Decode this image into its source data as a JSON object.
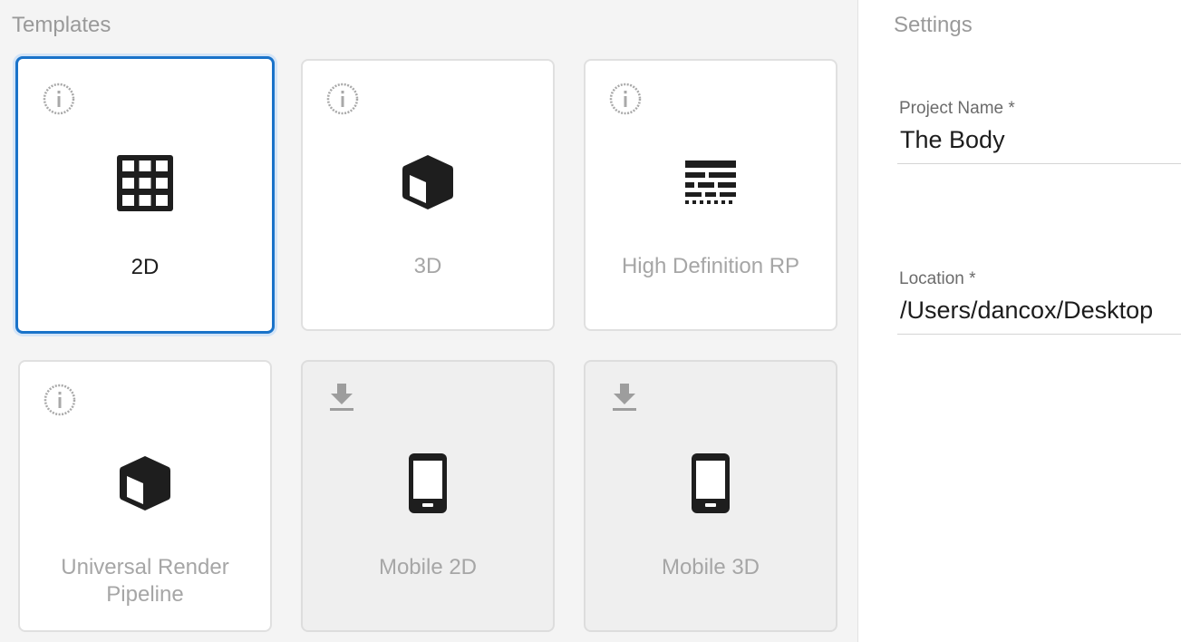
{
  "templates": {
    "title": "Templates",
    "cards": [
      {
        "label": "2D",
        "corner_icon": "info-icon",
        "main_icon": "grid-icon",
        "selected": true,
        "downloadable": false
      },
      {
        "label": "3D",
        "corner_icon": "info-icon",
        "main_icon": "cube-icon",
        "selected": false,
        "downloadable": false
      },
      {
        "label": "High Definition RP",
        "corner_icon": "info-icon",
        "main_icon": "brick-wall-icon",
        "selected": false,
        "downloadable": false
      },
      {
        "label": "Universal Render Pipeline",
        "corner_icon": "info-icon",
        "main_icon": "cube-icon",
        "selected": false,
        "downloadable": false
      },
      {
        "label": "Mobile 2D",
        "corner_icon": "download-icon",
        "main_icon": "phone-icon",
        "selected": false,
        "downloadable": true
      },
      {
        "label": "Mobile 3D",
        "corner_icon": "download-icon",
        "main_icon": "phone-icon",
        "selected": false,
        "downloadable": true
      }
    ]
  },
  "settings": {
    "title": "Settings",
    "project_name": {
      "label": "Project Name *",
      "value": "The Body"
    },
    "location": {
      "label": "Location *",
      "value": "/Users/dancox/Desktop"
    }
  },
  "colors": {
    "selected_border": "#1a73c9",
    "label_inactive": "#a6a6a6",
    "label_active": "#1c1c1c",
    "disabled_card_bg": "#efefef"
  }
}
